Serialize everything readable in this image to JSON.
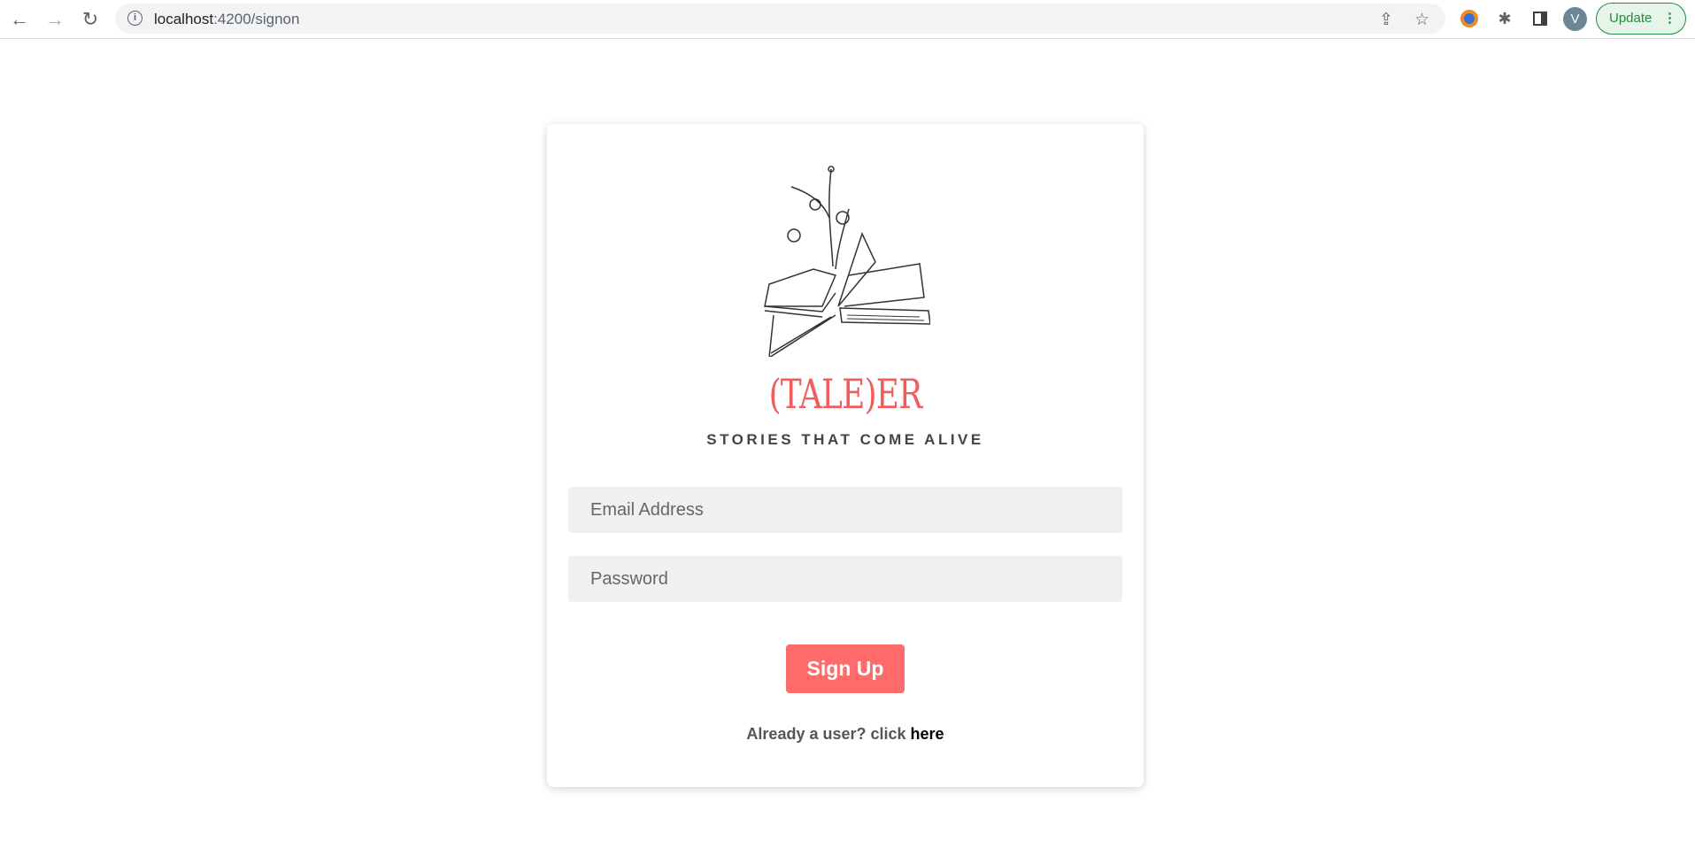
{
  "browser": {
    "url_host": "localhost",
    "url_path": ":4200/signon",
    "avatar_initial": "V",
    "update_label": "Update"
  },
  "brand": {
    "name": "(TALE)ER",
    "tagline": "STORIES THAT COME ALIVE"
  },
  "form": {
    "email_placeholder": "Email Address",
    "password_placeholder": "Password",
    "submit_label": "Sign Up"
  },
  "footer": {
    "prompt": "Already a user? click ",
    "link": "here"
  },
  "colors": {
    "accent": "#ff6b6b",
    "brand": "#f25c5c"
  }
}
